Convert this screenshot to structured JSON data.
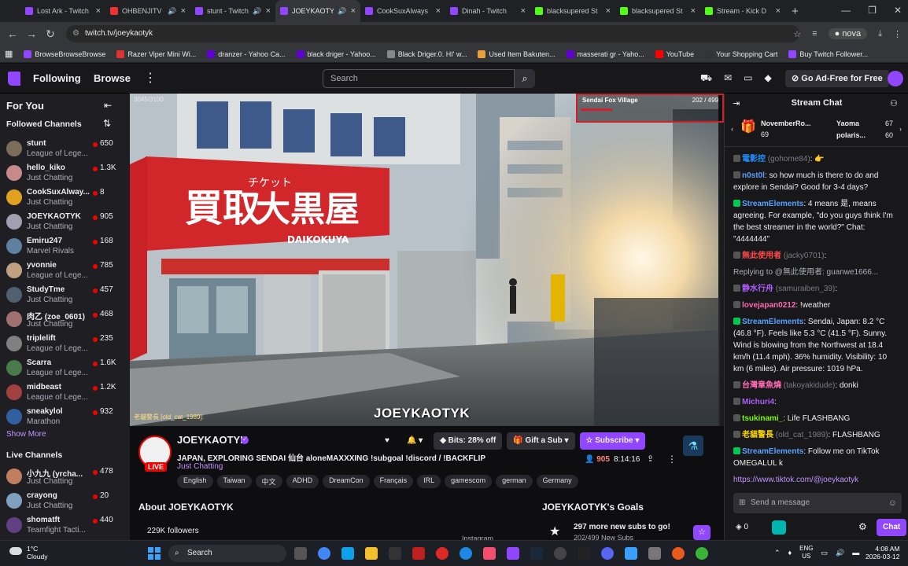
{
  "browser": {
    "tabs": [
      {
        "title": "Lost Ark - Twitch",
        "color": "#9147ff",
        "speaker": false,
        "active": false
      },
      {
        "title": "OHBENJITV",
        "color": "#e33",
        "speaker": true,
        "active": false
      },
      {
        "title": "stunt - Twitch",
        "color": "#9147ff",
        "speaker": true,
        "active": false
      },
      {
        "title": "JOEYKAOTYK",
        "color": "#9147ff",
        "speaker": true,
        "active": true
      },
      {
        "title": "CookSuxAlways",
        "color": "#9147ff",
        "speaker": false,
        "active": false
      },
      {
        "title": "Dinah - Twitch",
        "color": "#9147ff",
        "speaker": false,
        "active": false
      },
      {
        "title": "blacksupered St",
        "color": "#53fc18",
        "speaker": false,
        "active": false
      },
      {
        "title": "blacksupered St",
        "color": "#53fc18",
        "speaker": false,
        "active": false
      },
      {
        "title": "Stream - Kick D",
        "color": "#53fc18",
        "speaker": false,
        "active": false
      }
    ],
    "url": "twitch.tv/joeykaotyk",
    "profile": "nova",
    "bookmarks": [
      {
        "label": "BrowseBrowseBrowse",
        "color": "#9147ff"
      },
      {
        "label": "Razer Viper Mini Wi...",
        "color": "#d33"
      },
      {
        "label": "dranzer - Yahoo Ca...",
        "color": "#6001d2"
      },
      {
        "label": "black driger - Yahoo...",
        "color": "#6001d2"
      },
      {
        "label": "Black Driger.0. HI' w...",
        "color": "#888"
      },
      {
        "label": "Used Item Bakuten...",
        "color": "#e9a23b"
      },
      {
        "label": "masserati gr - Yaho...",
        "color": "#6001d2"
      },
      {
        "label": "YouTube",
        "color": "#f00"
      },
      {
        "label": "Your Shopping Cart",
        "color": "#333"
      },
      {
        "label": "Buy Twitch Follower...",
        "color": "#9147ff"
      }
    ]
  },
  "topnav": {
    "following": "Following",
    "browse": "Browse",
    "search_placeholder": "Search",
    "ad_free": "Go Ad-Free for Free"
  },
  "sidebar": {
    "for_you": "For You",
    "followed_title": "Followed Channels",
    "followed": [
      {
        "name": "stunt",
        "game": "League of Lege...",
        "viewers": "650",
        "color": "#7a6e5a"
      },
      {
        "name": "hello_kiko",
        "game": "Just Chatting",
        "viewers": "1.3K",
        "color": "#c68a8a"
      },
      {
        "name": "CookSuxAlway...",
        "game": "Just Chatting",
        "viewers": "8",
        "color": "#e0a020"
      },
      {
        "name": "JOEYKAOTYK",
        "game": "Just Chatting",
        "viewers": "905",
        "color": "#a0a0b0"
      },
      {
        "name": "Emiru247",
        "game": "Marvel Rivals",
        "viewers": "168",
        "color": "#6080a0"
      },
      {
        "name": "yvonnie",
        "game": "League of Lege...",
        "viewers": "785",
        "color": "#c0a080"
      },
      {
        "name": "StudyTme",
        "game": "Just Chatting",
        "viewers": "457",
        "color": "#506070"
      },
      {
        "name": "肉乙 (zoe_0601)",
        "game": "Just Chatting",
        "viewers": "468",
        "color": "#a07070"
      },
      {
        "name": "triplelift",
        "game": "League of Lege...",
        "viewers": "235",
        "color": "#808080"
      },
      {
        "name": "Scarra",
        "game": "League of Lege...",
        "viewers": "1.6K",
        "color": "#4a7a4a"
      },
      {
        "name": "midbeast",
        "game": "League of Lege...",
        "viewers": "1.2K",
        "color": "#a04040"
      },
      {
        "name": "sneakylol",
        "game": "Marathon",
        "viewers": "932",
        "color": "#3060a0"
      }
    ],
    "show_more": "Show More",
    "live_title": "Live Channels",
    "live": [
      {
        "name": "小九九 (yrcha...",
        "game": "Just Chatting",
        "viewers": "478",
        "color": "#c08060"
      },
      {
        "name": "crayong",
        "game": "Just Chatting",
        "viewers": "20",
        "color": "#80a0c0"
      },
      {
        "name": "shomatft",
        "game": "Teamfight Tacti...",
        "viewers": "440",
        "color": "#604080"
      }
    ]
  },
  "video": {
    "timestamp": "3045/3100",
    "location": "Sendai Fox Village",
    "goal": "202 / 499",
    "goal_fraction": 0.4,
    "watermark": "JOEYKAOTYK",
    "overlay_chat": "老貓警長 [old_cat_1989]:",
    "signs": {
      "shop": "大黒屋",
      "shop_latin": "DAIKOKUYA",
      "kaitori": "買取",
      "ticket": "チケット"
    }
  },
  "stream": {
    "name": "JOEYKAOTYK",
    "live": "LIVE",
    "title": "JAPAN, EXPLORING SENDAI 仙台 aloneMAXXXING !subgoal !discord / !BACKFLIP",
    "category": "Just Chatting",
    "tags": [
      "English",
      "Taiwan",
      "中文",
      "ADHD",
      "DreamCon",
      "Français",
      "IRL",
      "gamescom",
      "german",
      "Germany"
    ],
    "bits": "Bits: 28% off",
    "gift": "Gift a Sub",
    "subscribe": "Subscribe",
    "viewers": "905",
    "uptime": "8:14:16",
    "about": "About JOEYKAOTYK",
    "followers": "229K followers",
    "goals_title": "JOEYKAOTYK's Goals",
    "goal_text": "297 more new subs to go!",
    "goal_sub": "202/499 New Subs",
    "instagram": "Instagram"
  },
  "chat": {
    "title": "Stream Chat",
    "leaderboard": [
      {
        "name": "NovemberRo...",
        "value": "69"
      },
      {
        "name": "Yaoma",
        "value": "67"
      },
      {
        "name": "polaris...",
        "value": "60"
      }
    ],
    "messages": [
      {
        "user": "電影控",
        "handle": "(gohome84)",
        "color": "#1e90ff",
        "text": ": 👉"
      },
      {
        "user": "n0st0l",
        "handle": "",
        "color": "#5aa0ff",
        "text": ": so how much is there to do and explore in Sendai? Good for 3-4 days?"
      },
      {
        "user": "StreamElements",
        "handle": "",
        "color": "#5aa0ff",
        "text": ": 4 means 是, means agreeing. For example, \"do you guys think I'm the best streamer in the world?\" Chat: \"4444444\""
      },
      {
        "user": "無此使用者",
        "handle": "(jacky0701)",
        "color": "#ff4a4a",
        "text": ":"
      },
      {
        "user": "",
        "handle": "",
        "color": "#adadb8",
        "text": "Replying to @無此使用者: guanwe1666..."
      },
      {
        "user": "静水行舟",
        "handle": "(samuraiben_39)",
        "color": "#b05cff",
        "text": ":"
      },
      {
        "user": "lovejapan0212",
        "handle": "",
        "color": "#ff69b4",
        "text": ": !weather"
      },
      {
        "user": "StreamElements",
        "handle": "",
        "color": "#5aa0ff",
        "text": ": Sendai, Japan: 8.2 °C (46.8 °F). Feels like 5.3 °C (41.5 °F). Sunny. Wind is blowing from the Northwest at 18.4 km/h (11.4 mph). 36% humidity. Visibility: 10 km (6 miles). Air pressure: 1019 hPa."
      },
      {
        "user": "台灣章魚燒",
        "handle": "(takoyakidude)",
        "color": "#ff69b4",
        "text": ": donki"
      },
      {
        "user": "Michuri4",
        "handle": "",
        "color": "#b05cff",
        "text": ":"
      },
      {
        "user": "tsukinami_",
        "handle": "",
        "color": "#7cfc00",
        "text": ": Life FLASHBANG"
      },
      {
        "user": "老貓警長",
        "handle": "(old_cat_1989)",
        "color": "#ffd700",
        "text": ": FLASHBANG"
      },
      {
        "user": "StreamElements",
        "handle": "",
        "color": "#5aa0ff",
        "text": ": Follow me on TikTok OMEGALUL k"
      },
      {
        "user": "",
        "handle": "",
        "color": "#bf94ff",
        "text": "https://www.tiktok.com/@joeykaotyk"
      }
    ],
    "input_placeholder": "Send a message",
    "points": "0",
    "send": "Chat"
  },
  "taskbar": {
    "temp": "1°C",
    "weather": "Cloudy",
    "search": "Search",
    "lang1": "ENG",
    "lang2": "US",
    "time": "4:08 AM",
    "date": "2026-03-12"
  }
}
